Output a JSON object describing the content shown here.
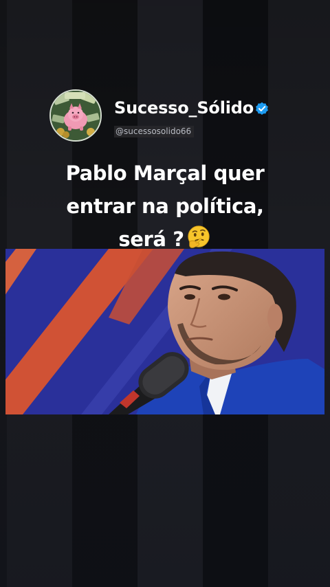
{
  "author": {
    "name": "Sucesso_Sólido",
    "handle": "@sucessosolido66",
    "verified": true,
    "avatar_icon": "piggy-bank-with-money-icon"
  },
  "post": {
    "title_lines": [
      "Pablo Marçal quer",
      "entrar na política,",
      "será ?"
    ],
    "emoji": "thinking-face-icon"
  },
  "video": {
    "thumbnail": "man-speaking-into-microphone-photo"
  },
  "colors": {
    "background": "#0b0c10",
    "text": "#ffffff",
    "verified_badge": "#1d9bf0",
    "video_blue": "#2e35a8",
    "video_orange": "#e25a3a",
    "suit": "#1e43b8"
  }
}
